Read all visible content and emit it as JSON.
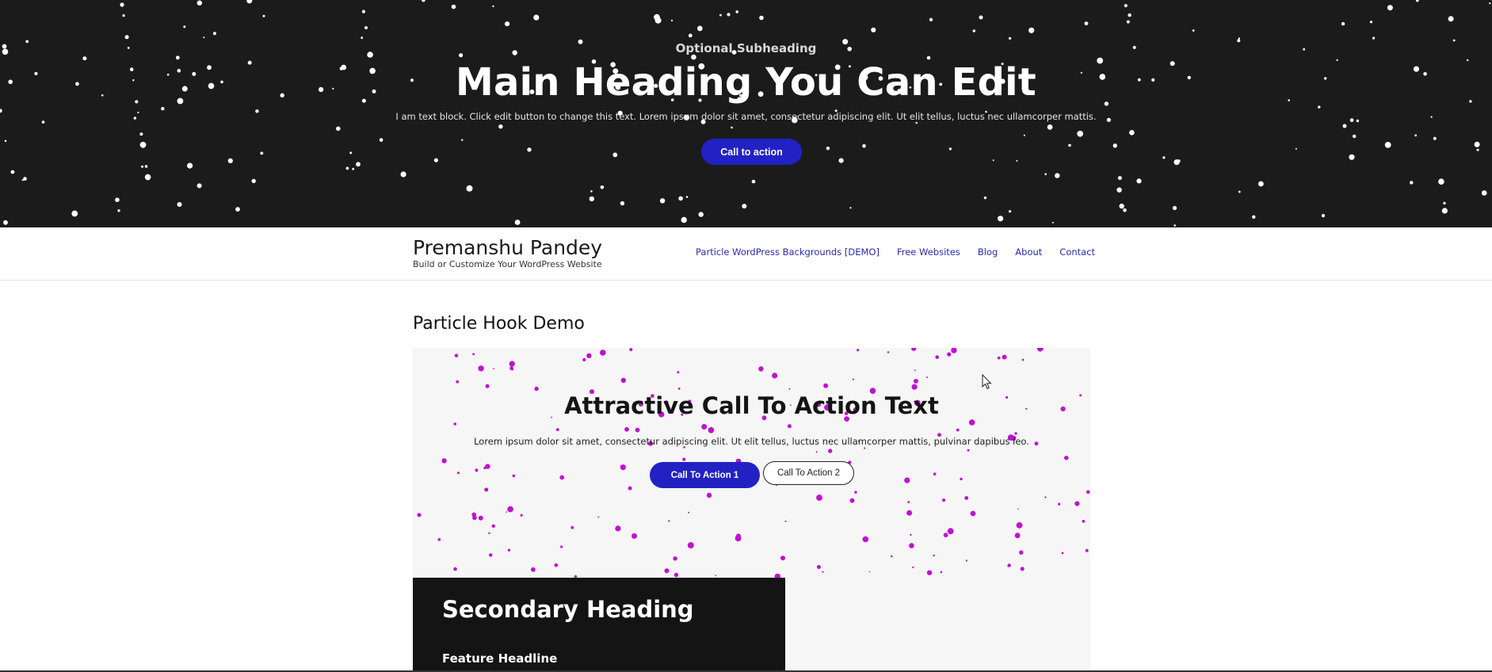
{
  "hero": {
    "subheading": "Optional Subheading",
    "title": "Main Heading You Can Edit",
    "text": "I am text block. Click edit button to change this text. Lorem ipsum dolor sit amet, consectetur adipiscing elit. Ut elit tellus, luctus nec ullamcorper mattis.",
    "button_label": "Call to action",
    "star_color": "#ffffff",
    "background_color": "#1b1b1b"
  },
  "header": {
    "site_name": "Premanshu Pandey",
    "tagline": "Build or Customize Your WordPress Website",
    "nav": [
      {
        "label": "Particle WordPress Backgrounds [DEMO]"
      },
      {
        "label": "Free Websites"
      },
      {
        "label": "Blog"
      },
      {
        "label": "About"
      },
      {
        "label": "Contact"
      }
    ]
  },
  "content": {
    "page_title": "Particle Hook Demo",
    "cta": {
      "title": "Attractive Call To Action Text",
      "text": "Lorem ipsum dolor sit amet, consectetur adipiscing elit. Ut elit tellus, luctus nec ullamcorper mattis, pulvinar dapibus leo.",
      "button1_label": "Call To Action 1",
      "button2_label": "Call To Action 2",
      "particle_color": "#c010d0"
    },
    "secondary": {
      "heading": "Secondary Heading",
      "feature_headline": "Feature Headline"
    }
  },
  "colors": {
    "accent": "#2222c4",
    "nav_link": "#2b2ba8"
  }
}
